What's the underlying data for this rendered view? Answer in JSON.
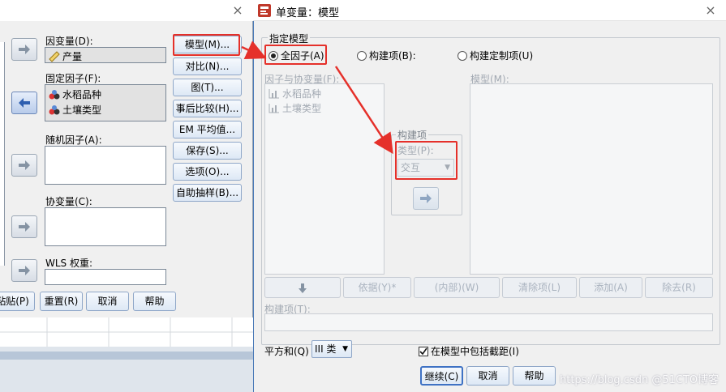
{
  "back": {
    "close_glyph": "×",
    "dependent_label": "因变量(D):",
    "dependent_item": "产量",
    "fixed_label": "固定因子(F):",
    "fixed_items": [
      "水稻品种",
      "土壤类型"
    ],
    "random_label": "随机因子(A):",
    "covariate_label": "协变量(C):",
    "wls_label": "WLS 权重:",
    "side_buttons": [
      "模型(M)...",
      "对比(N)...",
      "图(T)...",
      "事后比较(H)...",
      "EM 平均值...",
      "保存(S)...",
      "选项(O)...",
      "自助抽样(B)..."
    ],
    "bottom_buttons": [
      "粘贴(P)",
      "重置(R)",
      "取消",
      "帮助"
    ]
  },
  "front": {
    "title": "单变量：模型",
    "close_glyph": "×",
    "specify_group": "指定模型",
    "radio_full": "全因子(A)",
    "radio_build": "构建项(B):",
    "radio_custom": "构建定制项(U)",
    "factors_label": "因子与协变量(F):",
    "factor_items": [
      "水稻品种",
      "土壤类型"
    ],
    "model_label": "模型(M):",
    "build_group": "构建项",
    "type_label": "类型(P):",
    "type_value": "交互",
    "term_buttons": [
      "依据(Y)*",
      "(内部)(W)",
      "清除项(L)",
      "添加(A)",
      "除去(R)"
    ],
    "build_term_label": "构建项(T):",
    "sum_sq_label": "平方和(Q)",
    "sum_sq_value": "III 类",
    "include_intercept": "在模型中包括截距(I)",
    "include_intercept_checked": true,
    "footer_buttons": [
      "继续(C)",
      "取消",
      "帮助"
    ],
    "watermark": "https://blog.csdn @51CTO博客"
  },
  "colors": {
    "highlight": "#e5302a",
    "accent": "#4a7ab7"
  }
}
